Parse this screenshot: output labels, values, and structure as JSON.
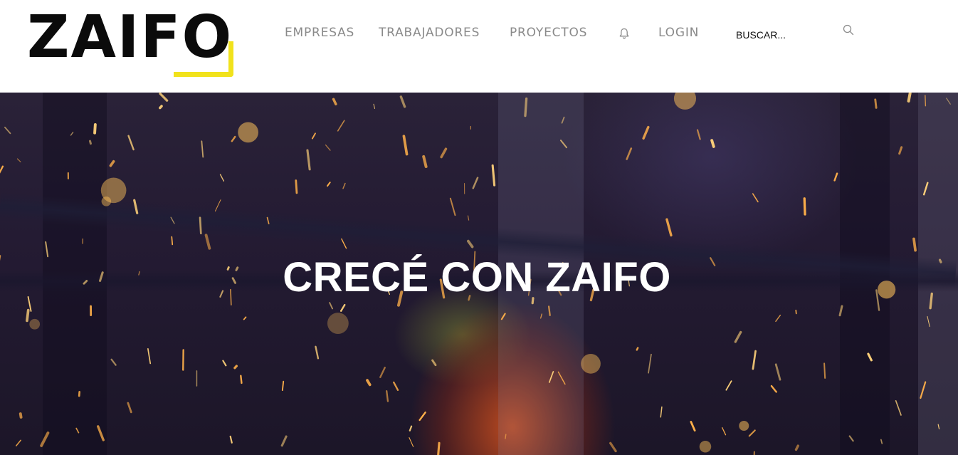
{
  "header": {
    "logo_text": "ZAIFO",
    "brand_accent": "#f1e21c",
    "nav": {
      "empresas": "EMPRESAS",
      "trabajadores": "TRABAJADORES",
      "proyectos": "PROYECTOS",
      "notifications_icon": "bell-icon",
      "login": "LOGIN"
    },
    "search": {
      "placeholder": "BUSCAR...",
      "icon": "search-icon"
    }
  },
  "hero": {
    "title": "CRECÉ CON ZAIFO"
  }
}
